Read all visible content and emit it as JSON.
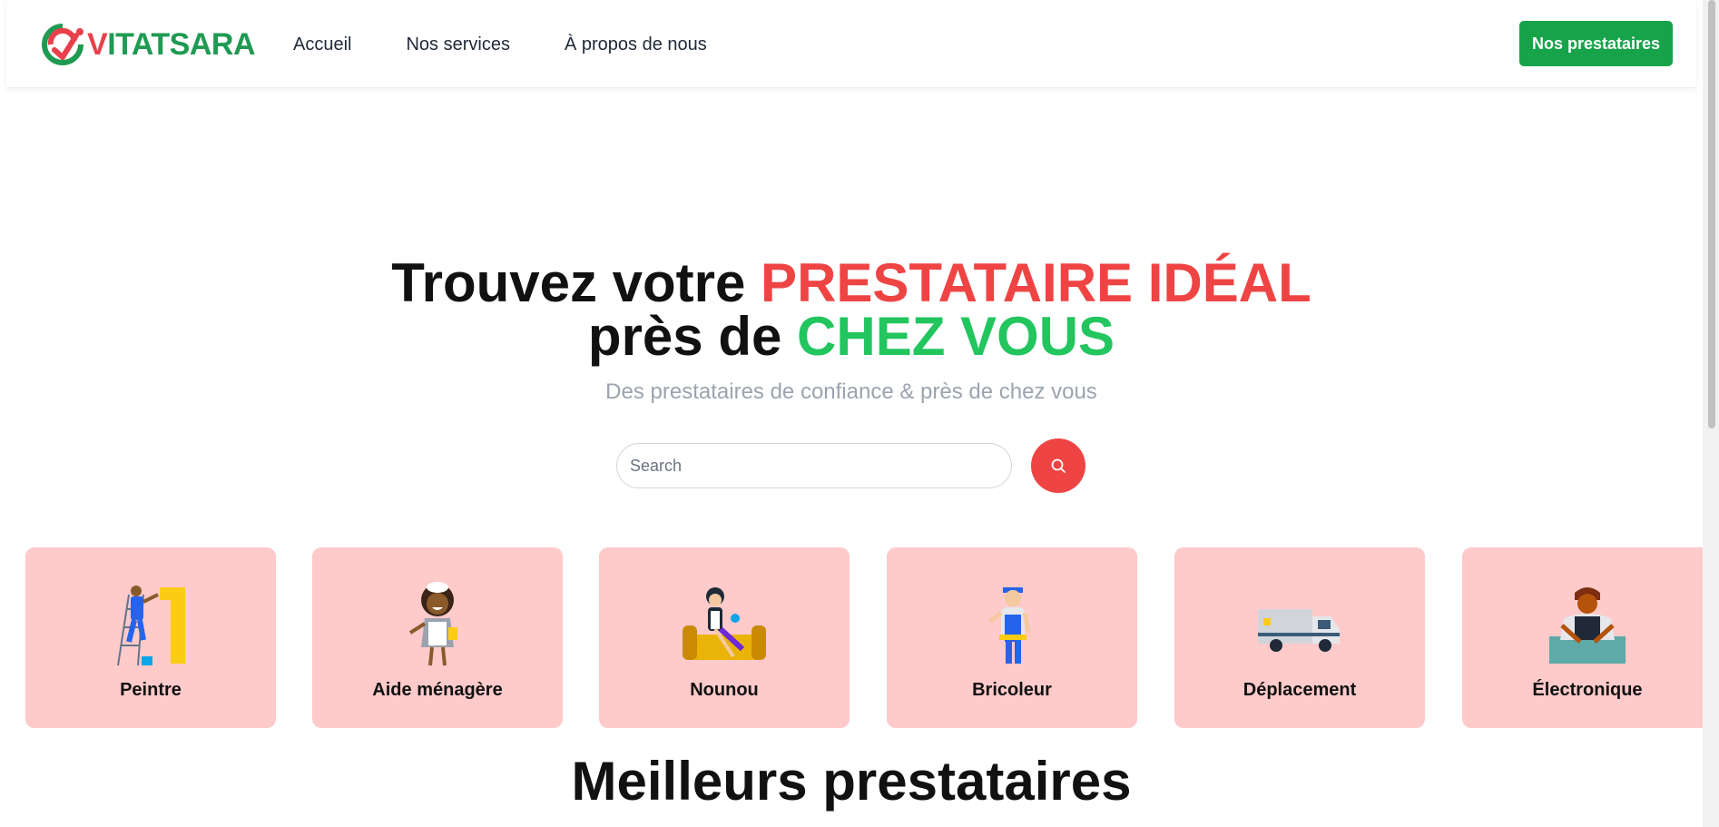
{
  "header": {
    "logo": {
      "text_first": "V",
      "text_rest": "ITATSARA"
    },
    "nav": [
      {
        "label": "Accueil"
      },
      {
        "label": "Nos services"
      },
      {
        "label": "À propos de nous"
      }
    ],
    "cta_label": "Nos prestataires"
  },
  "hero": {
    "title_line1_plain": "Trouvez votre ",
    "title_line1_accent": "PRESTATAIRE IDÉAL",
    "title_line2_plain": "près de ",
    "title_line2_accent": "CHEZ VOUS",
    "subtitle": "Des prestataires de confiance & près de chez vous"
  },
  "search": {
    "placeholder": "Search",
    "value": ""
  },
  "categories": [
    {
      "label": "Peintre",
      "icon": "painter-illustration"
    },
    {
      "label": "Aide ménagère",
      "icon": "housekeeper-illustration"
    },
    {
      "label": "Nounou",
      "icon": "nanny-illustration"
    },
    {
      "label": "Bricoleur",
      "icon": "handyman-illustration"
    },
    {
      "label": "Déplacement",
      "icon": "moving-truck-illustration"
    },
    {
      "label": "Électronique",
      "icon": "electronics-technician-illustration"
    }
  ],
  "section_title": "Meilleurs prestataires",
  "colors": {
    "brand_red": "#ef4444",
    "brand_green": "#16a34a",
    "card_bg": "#fecaca",
    "subtitle_gray": "#9ca3af"
  }
}
